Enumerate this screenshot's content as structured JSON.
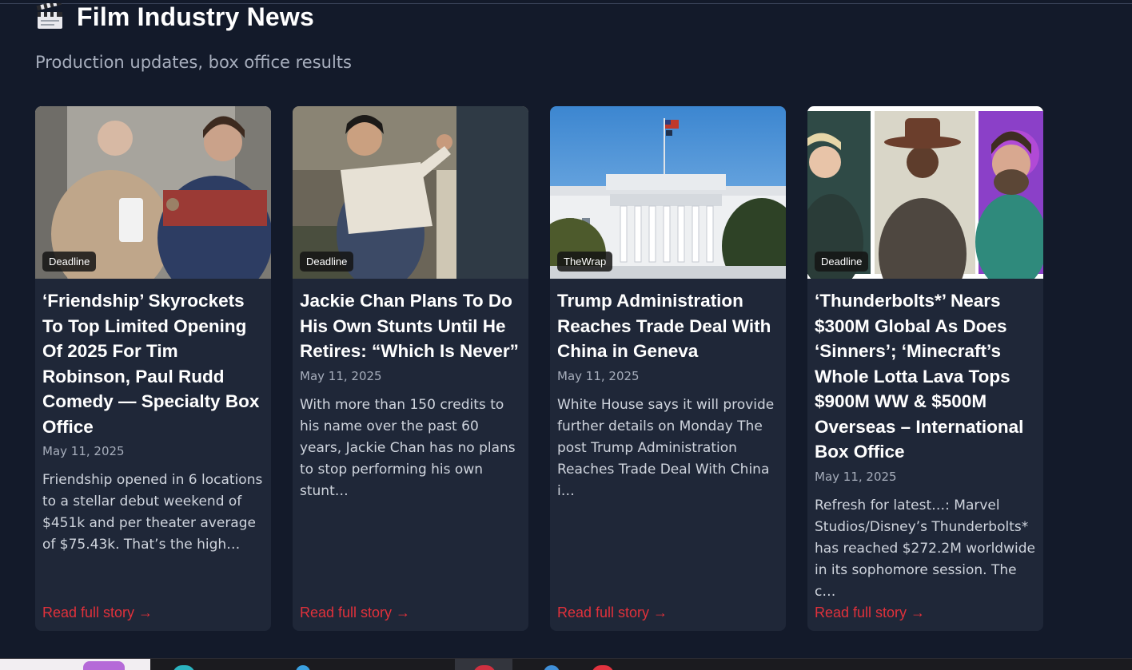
{
  "header": {
    "icon": "clapperboard-icon",
    "title": "Film Industry News",
    "subtitle": "Production updates, box office results"
  },
  "colors": {
    "background": "#131a2a",
    "card": "#1f2738",
    "accent_link": "#e0313b"
  },
  "articles": [
    {
      "source": "Deadline",
      "headline": "‘Friendship’ Skyrockets To Top Limited Opening Of 2025 For Tim Robinson, Paul Rudd Comedy — Specialty Box Office",
      "date": "May 11, 2025",
      "excerpt": "Friendship opened in 6 locations to a stellar debut weekend of $451k and per theater average of $75.43k. That’s the high…",
      "link": "Read full story →"
    },
    {
      "source": "Deadline",
      "headline": "Jackie Chan Plans To Do His Own Stunts Until He Retires: “Which Is Never”",
      "date": "May 11, 2025",
      "excerpt": "With more than 150 credits to his name over the past 60 years, Jackie Chan has no plans to stop performing his own stunt…",
      "link": "Read full story →"
    },
    {
      "source": "TheWrap",
      "headline": "Trump Administration Reaches Trade Deal With China in Geneva",
      "date": "May 11, 2025",
      "excerpt": "White House says it will provide further details on Monday The post Trump Administration Reaches Trade Deal With China i…",
      "link": "Read full story →"
    },
    {
      "source": "Deadline",
      "headline": "‘Thunderbolts*’ Nears $300M Global As Does ‘Sinners’; ‘Minecraft’s Whole Lotta Lava Tops $900M WW & $500M Overseas – International Box Office",
      "date": "May 11, 2025",
      "excerpt": "Refresh for latest…: Marvel Studios/Disney’s Thunderbolts* has reached $272.2M worldwide in its sophomore session. The c…",
      "link": "Read full story →"
    }
  ]
}
